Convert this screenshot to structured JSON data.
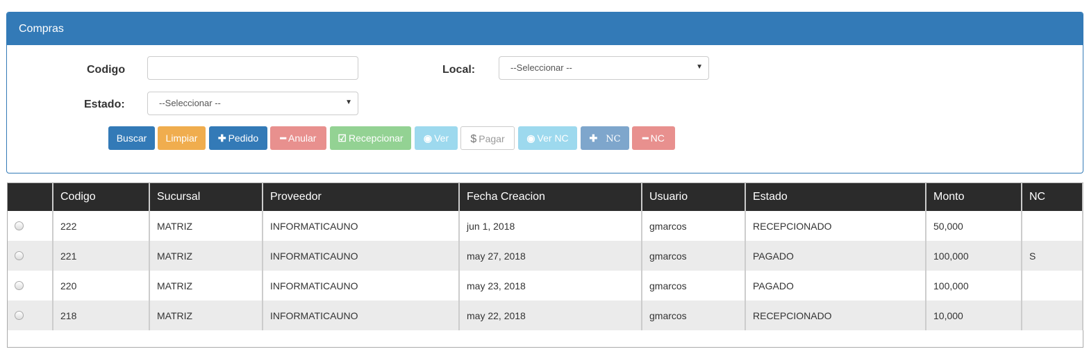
{
  "panel": {
    "title": "Compras"
  },
  "form": {
    "codigo_label": "Codigo",
    "codigo_value": "",
    "local_label": "Local:",
    "local_value": "--Seleccionar --",
    "estado_label": "Estado:",
    "estado_value": "--Seleccionar --"
  },
  "buttons": {
    "buscar": "Buscar",
    "limpiar": "Limpiar",
    "pedido": "Pedido",
    "anular": "Anular",
    "recepcionar": "Recepcionar",
    "ver": "Ver",
    "pagar": "Pagar",
    "ver_nc": "Ver NC",
    "add_nc": "NC",
    "remove_nc": "NC"
  },
  "colors": {
    "primary": "#337ab7",
    "warning": "#f0ad4e",
    "danger_light": "#e8908e",
    "success_light": "#93d293",
    "info_light": "#9dd9ee",
    "header_dark": "#2b2b2b"
  },
  "table": {
    "headers": [
      "",
      "Codigo",
      "Sucursal",
      "Proveedor",
      "Fecha Creacion",
      "Usuario",
      "Estado",
      "Monto",
      "NC"
    ],
    "rows": [
      [
        "222",
        "MATRIZ",
        "INFORMATICAUNO",
        "jun 1, 2018",
        "gmarcos",
        "RECEPCIONADO",
        "50,000",
        ""
      ],
      [
        "221",
        "MATRIZ",
        "INFORMATICAUNO",
        "may 27, 2018",
        "gmarcos",
        "PAGADO",
        "100,000",
        "S"
      ],
      [
        "220",
        "MATRIZ",
        "INFORMATICAUNO",
        "may 23, 2018",
        "gmarcos",
        "PAGADO",
        "100,000",
        ""
      ],
      [
        "218",
        "MATRIZ",
        "INFORMATICAUNO",
        "may 22, 2018",
        "gmarcos",
        "RECEPCIONADO",
        "10,000",
        ""
      ]
    ]
  }
}
